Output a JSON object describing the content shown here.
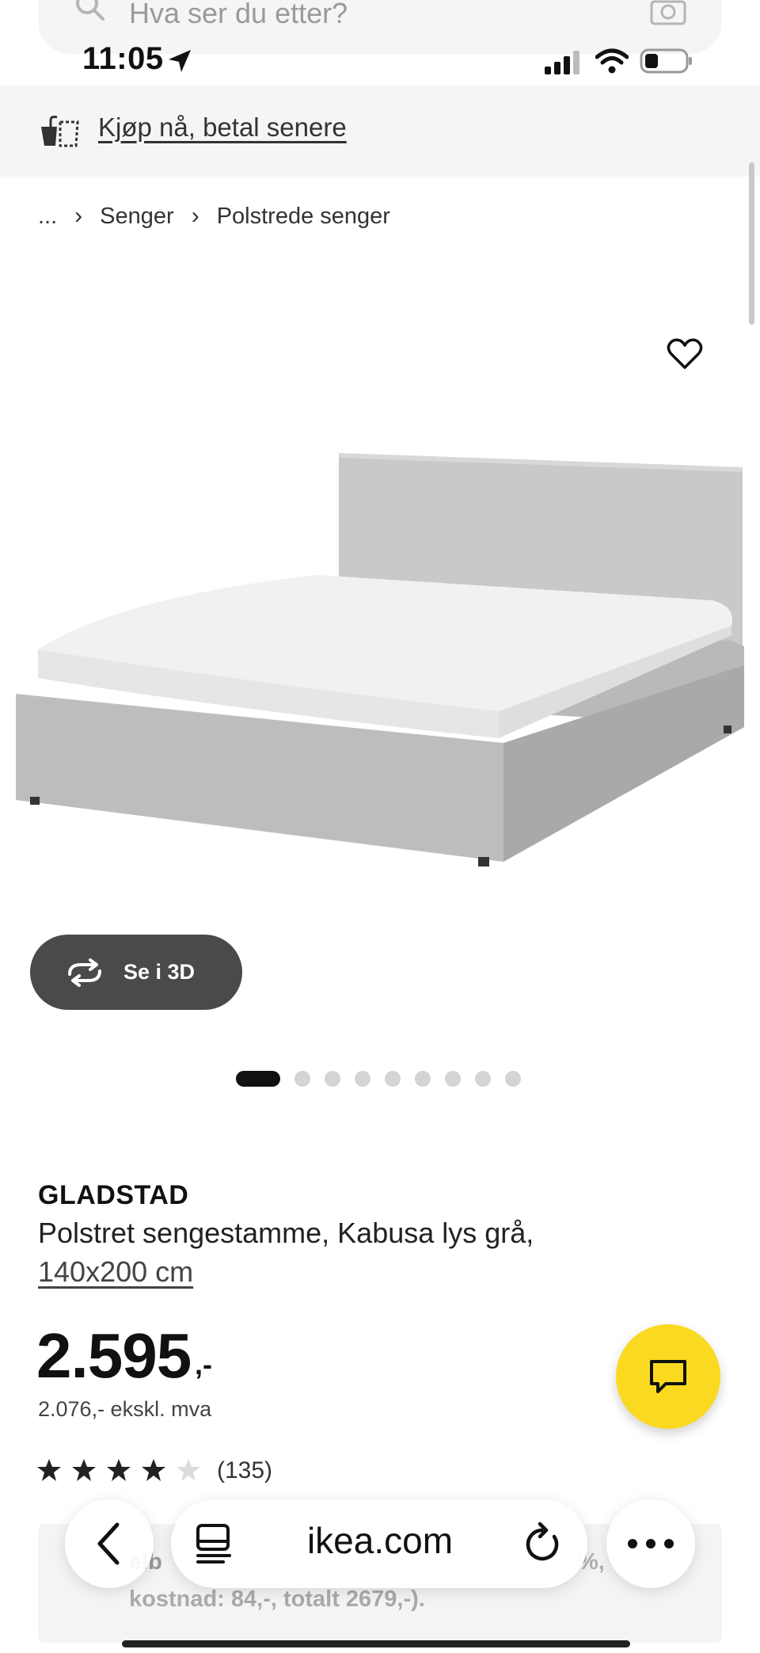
{
  "search": {
    "placeholder": "Hva ser du etter?"
  },
  "status_bar": {
    "time": "11:05"
  },
  "banner": {
    "link_text": "Kjøp nå, betal senere"
  },
  "breadcrumb": {
    "ellipsis": "...",
    "items": [
      "Senger",
      "Polstrede senger"
    ]
  },
  "gallery": {
    "view_3d_label": "Se i 3D",
    "image_count": 9,
    "active_index": 0
  },
  "product": {
    "name": "GLADSTAD",
    "description": "Polstret sengestamme, Kabusa lys grå,",
    "size": "140x200 cm",
    "price": "2.595",
    "price_suffix": ",-",
    "price_ex_vat": "2.076,- ekskl. mva",
    "rating": 4,
    "rating_max": 5,
    "reviews": "(135)"
  },
  "info_box": {
    "line1": "elb",
    "pct": "%,",
    "line2": "kostnad: 84,-, totalt 2679,-)."
  },
  "browser": {
    "domain": "ikea.com"
  },
  "colors": {
    "chat_button": "#fada20",
    "view_3d_button": "#4a4a4a",
    "banner_bg": "#f5f5f5"
  }
}
